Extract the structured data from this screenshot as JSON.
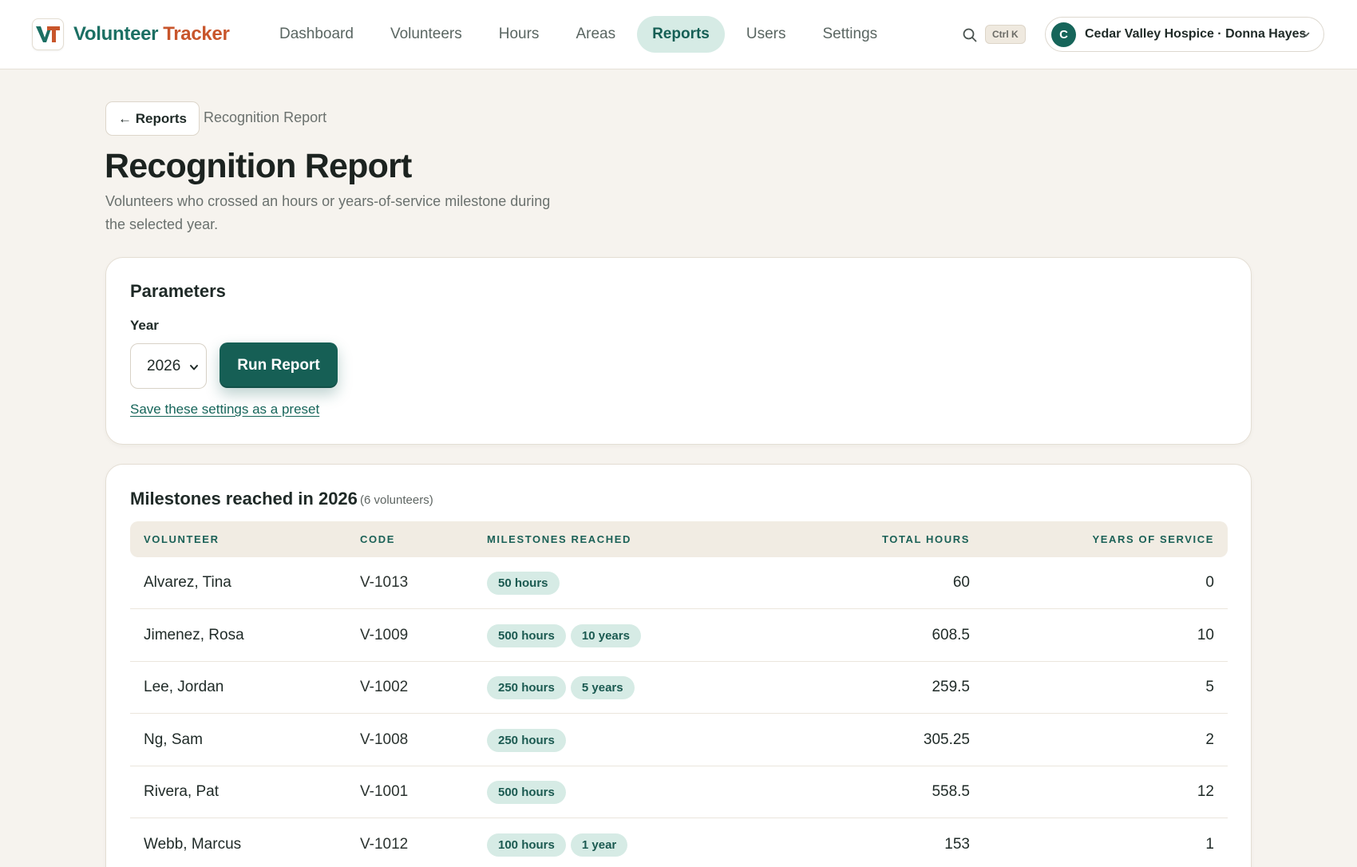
{
  "brand": {
    "logo_text": "VT",
    "name_a": "Volunteer",
    "name_b": "Tracker"
  },
  "nav": {
    "items": [
      {
        "label": "Dashboard",
        "active": false
      },
      {
        "label": "Volunteers",
        "active": false
      },
      {
        "label": "Hours",
        "active": false
      },
      {
        "label": "Areas",
        "active": false
      },
      {
        "label": "Reports",
        "active": true
      },
      {
        "label": "Users",
        "active": false
      },
      {
        "label": "Settings",
        "active": false
      }
    ],
    "search_icon": "search-icon",
    "shortcut": "Ctrl K",
    "org": {
      "avatar": "C",
      "label": "Cedar Valley Hospice · Donna Hayes",
      "chevron": "chevron-down-icon"
    }
  },
  "header": {
    "back_label": "← Reports",
    "breadcrumb": "Recognition Report",
    "title": "Recognition Report",
    "subtitle": "Volunteers who crossed an hours or years-of-service milestone during the selected year."
  },
  "params": {
    "title": "Parameters",
    "year_label": "Year",
    "year_value": "2026",
    "run_label": "Run Report",
    "preset_link": "Save these settings as a preset"
  },
  "results": {
    "title": "Milestones reached in 2026",
    "count": "(6 volunteers)",
    "columns": [
      "Volunteer",
      "Code",
      "Milestones Reached",
      "Total Hours",
      "Years of Service"
    ],
    "rows": [
      {
        "name": "Alvarez, Tina",
        "code": "V-1013",
        "milestones": [
          "50 hours"
        ],
        "hours": "60",
        "years": "0"
      },
      {
        "name": "Jimenez, Rosa",
        "code": "V-1009",
        "milestones": [
          "500 hours",
          "10 years"
        ],
        "hours": "608.5",
        "years": "10"
      },
      {
        "name": "Lee, Jordan",
        "code": "V-1002",
        "milestones": [
          "250 hours",
          "5 years"
        ],
        "hours": "259.5",
        "years": "5"
      },
      {
        "name": "Ng, Sam",
        "code": "V-1008",
        "milestones": [
          "250 hours"
        ],
        "hours": "305.25",
        "years": "2"
      },
      {
        "name": "Rivera, Pat",
        "code": "V-1001",
        "milestones": [
          "500 hours"
        ],
        "hours": "558.5",
        "years": "12"
      },
      {
        "name": "Webb, Marcus",
        "code": "V-1012",
        "milestones": [
          "100 hours",
          "1 year"
        ],
        "hours": "153",
        "years": "1"
      }
    ]
  },
  "colors": {
    "accent": "#165f55",
    "brand_orange": "#c8552b",
    "badge_bg": "#d6ebe5",
    "page_bg": "#f6f3ee"
  }
}
